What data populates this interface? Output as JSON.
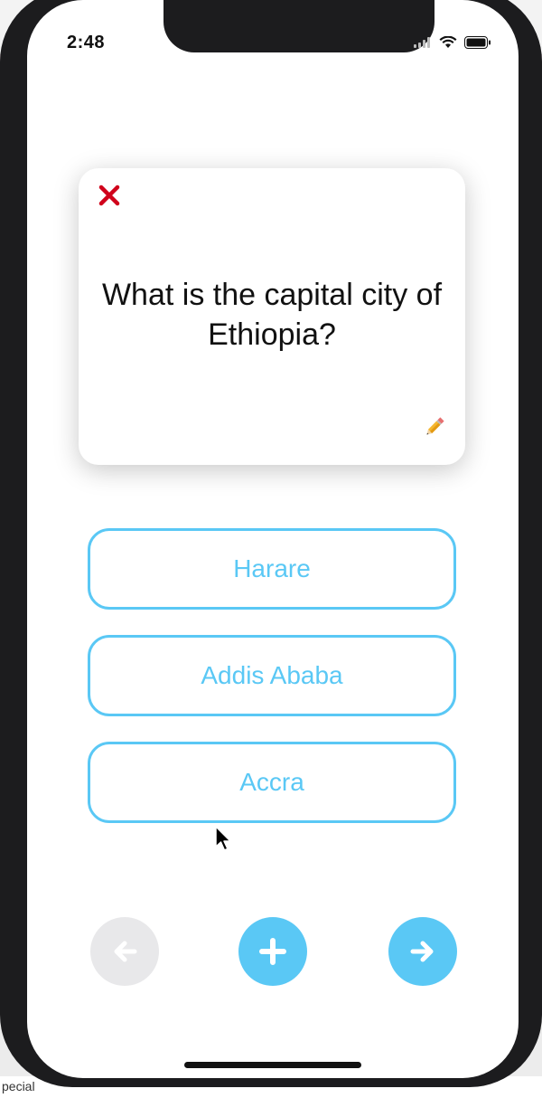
{
  "status_bar": {
    "time": "2:48",
    "icons": [
      "signal-icon",
      "wifi-icon",
      "battery-icon"
    ]
  },
  "card": {
    "question": "What is the capital city of Ethiopia?",
    "close_icon": "close-icon",
    "edit_icon": "pencil-icon"
  },
  "answers": [
    {
      "label": "Harare"
    },
    {
      "label": "Addis Ababa"
    },
    {
      "label": "Accra"
    }
  ],
  "navigation": {
    "previous_icon": "arrow-left-icon",
    "add_icon": "plus-icon",
    "next_icon": "arrow-right-icon"
  },
  "colors": {
    "accent": "#5ac8f5",
    "close": "#d0021b",
    "disabled": "#e8e8ea"
  },
  "background_text": "pecial"
}
